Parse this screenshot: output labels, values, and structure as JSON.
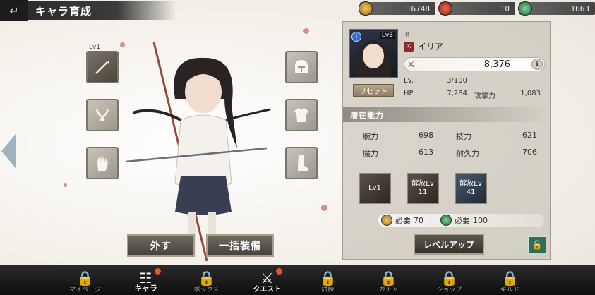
{
  "header": {
    "title": "キャラ育成",
    "back_icon": "back-arrow-icon"
  },
  "currencies": [
    {
      "name": "gold-coin-icon",
      "value": "16748",
      "color": "#c9962e"
    },
    {
      "name": "red-gem-icon",
      "value": "10",
      "color": "#c23a2a"
    },
    {
      "name": "green-gem-icon",
      "value": "1663",
      "color": "#3c9a5c"
    }
  ],
  "equipment": {
    "weapon": {
      "level": "Lv1",
      "icon": "spear-icon"
    },
    "accessory": {
      "icon": "necklace-icon"
    },
    "gloves": {
      "icon": "glove-icon"
    },
    "helmet": {
      "icon": "helmet-icon"
    },
    "armor": {
      "icon": "armor-icon"
    },
    "boots": {
      "icon": "boots-icon"
    }
  },
  "buttons": {
    "unequip": "外す",
    "equip_all": "一括装備",
    "level_up": "レベルアップ",
    "reset": "リセット"
  },
  "character": {
    "card_level": "Lv3",
    "badge": "i",
    "rarity": "R",
    "name": "イリア",
    "power": "8,376",
    "level_label": "Lv.",
    "level_value": "3/100",
    "hp_label": "HP",
    "hp_value": "7,284",
    "atk_label": "攻撃力",
    "atk_value": "1,083"
  },
  "potential": {
    "title": "潜在能力",
    "stats": [
      {
        "label": "腕力",
        "value": "698"
      },
      {
        "label": "技力",
        "value": "621"
      },
      {
        "label": "魔力",
        "value": "613"
      },
      {
        "label": "耐久力",
        "value": "706"
      }
    ]
  },
  "skills": [
    {
      "line1": "",
      "line2": "Lv1"
    },
    {
      "line1": "解放Lv",
      "line2": "11"
    },
    {
      "line1": "解放Lv",
      "line2": "41"
    }
  ],
  "requirements": [
    {
      "label": "必要",
      "value": "70",
      "color": "#c9962e"
    },
    {
      "label": "必要",
      "value": "100",
      "color": "#3c9a5c"
    }
  ],
  "nav": [
    {
      "label": "マイページ",
      "icon": "lock-icon",
      "active": false
    },
    {
      "label": "キャラ",
      "icon": "characters-icon",
      "active": true
    },
    {
      "label": "ボックス",
      "icon": "lock-icon",
      "active": false
    },
    {
      "label": "クエスト",
      "icon": "crossed-swords-icon",
      "active": false
    },
    {
      "label": "試練",
      "icon": "lock-icon",
      "active": false
    },
    {
      "label": "ガチャ",
      "icon": "lock-icon",
      "active": false
    },
    {
      "label": "ショップ",
      "icon": "lock-icon",
      "active": false
    },
    {
      "label": "ギルド",
      "icon": "lock-icon",
      "active": false
    }
  ]
}
